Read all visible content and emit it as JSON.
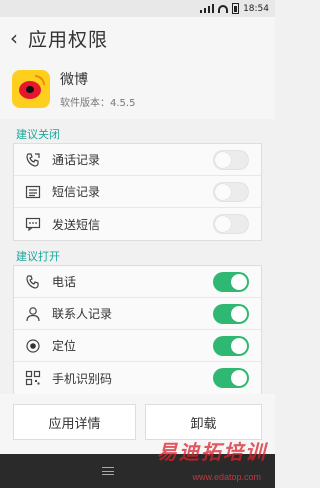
{
  "status_bar": {
    "time": "18:54"
  },
  "app_bar": {
    "back_label": "‹",
    "title": "应用权限"
  },
  "app": {
    "name": "微博",
    "version": "软件版本：4.5.5"
  },
  "sections": [
    {
      "label": "建议关闭",
      "items": [
        {
          "label": "通话记录",
          "icon": "phone-log-icon",
          "enabled": false
        },
        {
          "label": "短信记录",
          "icon": "message-list-icon",
          "enabled": false
        },
        {
          "label": "发送短信",
          "icon": "send-sms-icon",
          "enabled": false
        }
      ]
    },
    {
      "label": "建议打开",
      "items": [
        {
          "label": "电话",
          "icon": "phone-icon",
          "enabled": true
        },
        {
          "label": "联系人记录",
          "icon": "contact-icon",
          "enabled": true
        },
        {
          "label": "定位",
          "icon": "location-icon",
          "enabled": true
        },
        {
          "label": "手机识别码",
          "icon": "qr-icon",
          "enabled": true
        }
      ]
    }
  ],
  "buttons": {
    "details": "应用详情",
    "uninstall": "卸载"
  },
  "watermark": {
    "brand": "易迪拓培训",
    "url": "www.edatop.com"
  },
  "colors": {
    "accent": "#19a89a",
    "toggle_on": "#2eb872",
    "weibo_yellow": "#ffcf1f",
    "weibo_red": "#e6162d"
  }
}
